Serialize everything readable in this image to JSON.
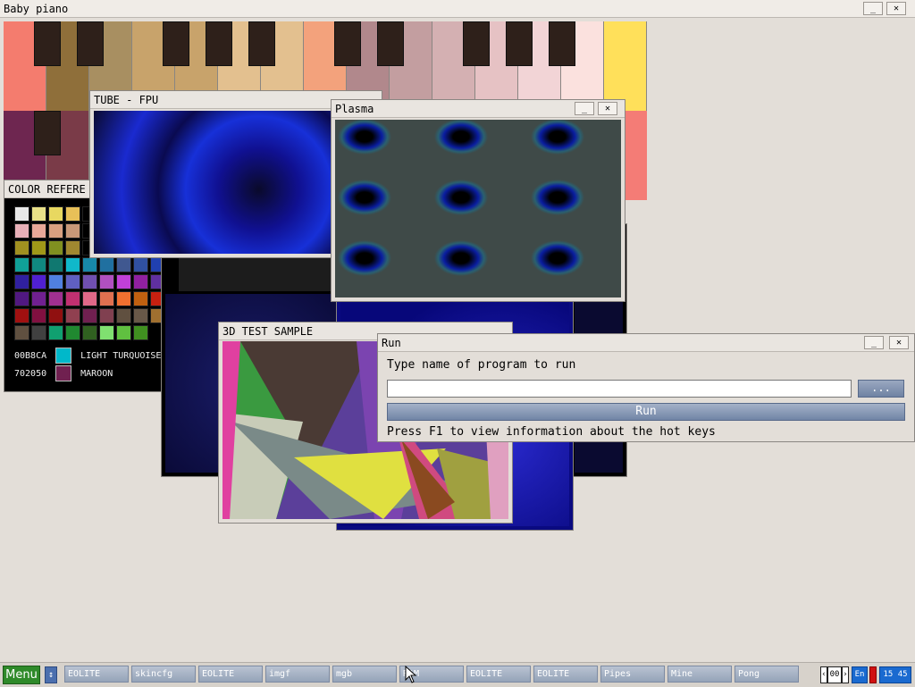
{
  "piano": {
    "title": "Baby piano",
    "minimize": "_",
    "close": "✕"
  },
  "colorref": {
    "title": "COLOR REFERE",
    "row1": {
      "hex": "00B8CA",
      "name": "LIGHT TURQUOISE",
      "color": "#00b8ca"
    },
    "row2": {
      "hex": "702050",
      "name": "MAROON",
      "color": "#702050"
    }
  },
  "tube": {
    "title": "TUBE - FPU"
  },
  "plasma": {
    "title": "Plasma",
    "minimize": "_",
    "close": "✕"
  },
  "test3d": {
    "title": "3D TEST SAMPLE"
  },
  "run": {
    "title": "Run",
    "minimize": "_",
    "close": "✕",
    "label": "Type name of program to run",
    "input_value": "",
    "browse_label": "...",
    "run_label": "Run",
    "hint": "Press F1 to view information about the hot keys"
  },
  "taskbar": {
    "menu_label": "Menu",
    "tasks": [
      "EOLITE",
      "skincfg",
      "EOLITE",
      "imgf",
      "mgb",
      "RAM",
      "EOLITE",
      "EOLITE",
      "Pipes",
      "Mine",
      "Pong"
    ],
    "page": "00",
    "lang": "En",
    "time": "15 45"
  },
  "colors": {
    "accent": "#2f8a2a",
    "button": "#7185a6",
    "desktop": "#e3ded8"
  }
}
